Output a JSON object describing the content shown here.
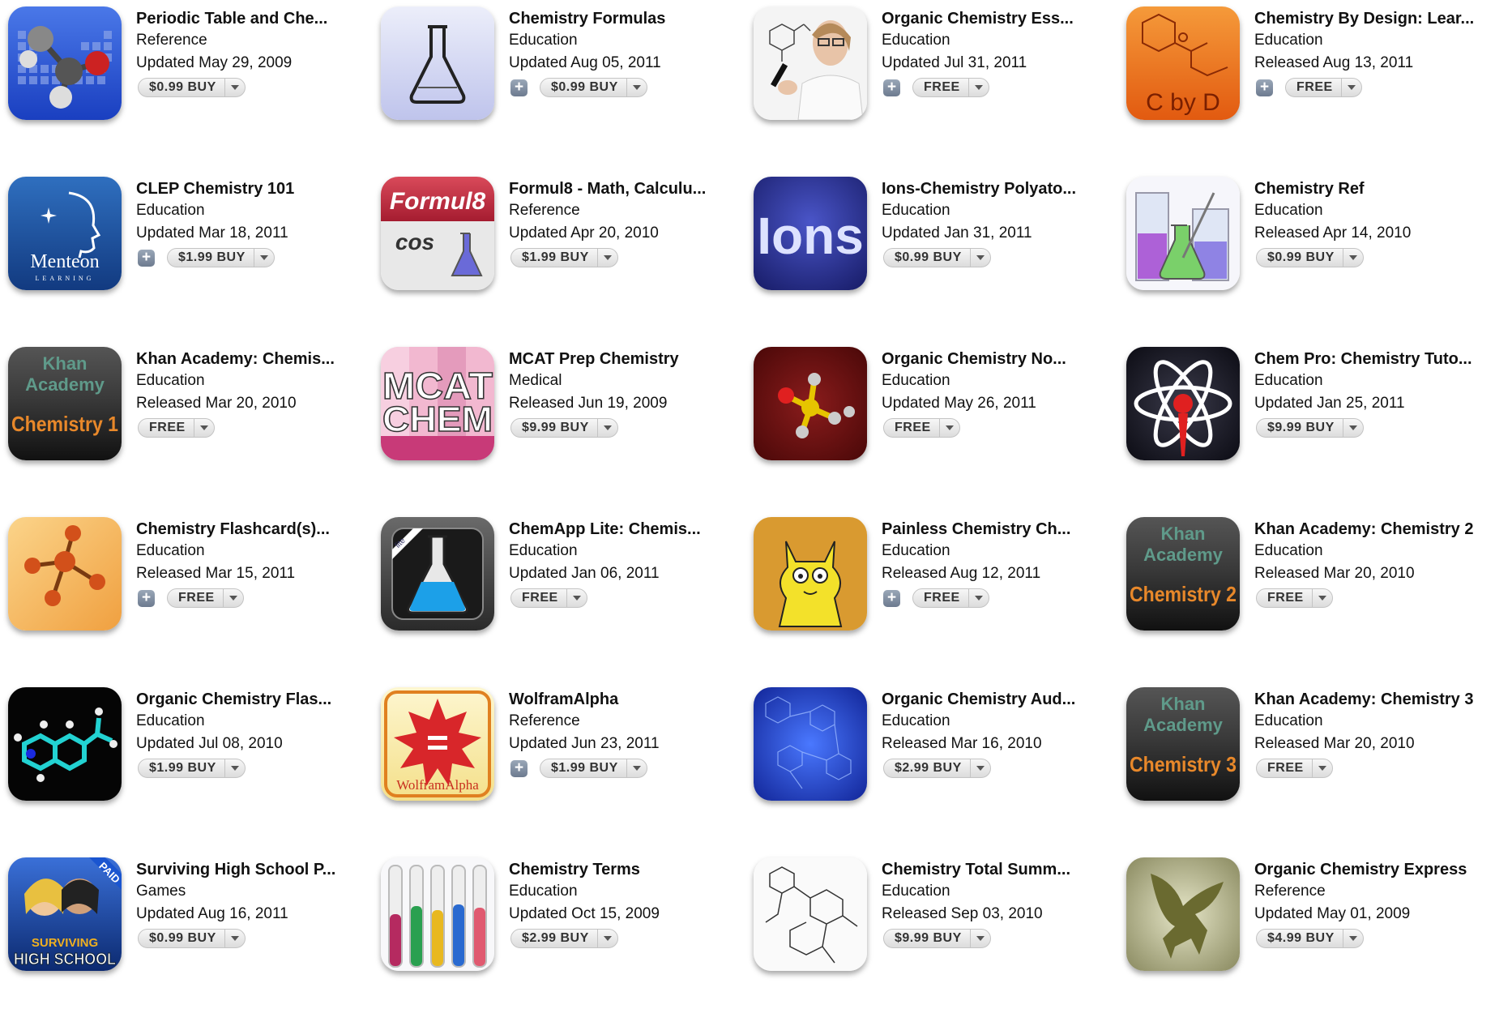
{
  "apps": [
    {
      "name": "Periodic Table and Che...",
      "category": "Reference",
      "date": "Updated May 29, 2009",
      "price": "$0.99  BUY",
      "plus": false,
      "icon": "periodic-table-icon"
    },
    {
      "name": "Chemistry Formulas",
      "category": "Education",
      "date": "Updated Aug 05, 2011",
      "price": "$0.99  BUY",
      "plus": true,
      "icon": "flask-icon"
    },
    {
      "name": "Organic Chemistry Ess...",
      "category": "Education",
      "date": "Updated Jul 31, 2011",
      "price": "FREE",
      "plus": true,
      "icon": "scientist-icon"
    },
    {
      "name": "Chemistry By Design: Lear...",
      "category": "Education",
      "date": "Released Aug 13, 2011",
      "price": "FREE",
      "plus": true,
      "icon": "c-by-d-icon"
    },
    {
      "name": "CLEP Chemistry 101",
      "category": "Education",
      "date": "Updated Mar 18, 2011",
      "price": "$1.99  BUY",
      "plus": true,
      "icon": "menteon-icon"
    },
    {
      "name": "Formul8 - Math, Calculu...",
      "category": "Reference",
      "date": "Updated Apr 20, 2010",
      "price": "$1.99  BUY",
      "plus": false,
      "icon": "formul8-icon"
    },
    {
      "name": "Ions-Chemistry Polyato...",
      "category": "Education",
      "date": "Updated Jan 31, 2011",
      "price": "$0.99  BUY",
      "plus": false,
      "icon": "ions-icon"
    },
    {
      "name": "Chemistry Ref",
      "category": "Education",
      "date": "Released Apr 14, 2010",
      "price": "$0.99  BUY",
      "plus": false,
      "icon": "beakers-icon"
    },
    {
      "name": "Khan Academy: Chemis...",
      "category": "Education",
      "date": "Released Mar 20, 2010",
      "price": "FREE",
      "plus": false,
      "icon": "khan-chemistry-1-icon"
    },
    {
      "name": "MCAT Prep Chemistry",
      "category": "Medical",
      "date": "Released Jun 19, 2009",
      "price": "$9.99  BUY",
      "plus": false,
      "icon": "mcat-chem-icon"
    },
    {
      "name": "Organic Chemistry No...",
      "category": "Education",
      "date": "Updated May 26, 2011",
      "price": "FREE",
      "plus": false,
      "icon": "molecule-icon"
    },
    {
      "name": "Chem Pro: Chemistry Tuto...",
      "category": "Education",
      "date": "Updated Jan 25, 2011",
      "price": "$9.99  BUY",
      "plus": false,
      "icon": "atom-icon"
    },
    {
      "name": "Chemistry Flashcard(s)...",
      "category": "Education",
      "date": "Released Mar 15, 2011",
      "price": "FREE",
      "plus": true,
      "icon": "flashcard-molecule-icon"
    },
    {
      "name": "ChemApp Lite: Chemis...",
      "category": "Education",
      "date": "Updated Jan 06, 2011",
      "price": "FREE",
      "plus": false,
      "icon": "chemapp-flask-icon"
    },
    {
      "name": "Painless Chemistry Ch...",
      "category": "Education",
      "date": "Released Aug 12, 2011",
      "price": "FREE",
      "plus": true,
      "icon": "cartoon-cat-icon"
    },
    {
      "name": "Khan Academy: Chemistry 2",
      "category": "Education",
      "date": "Released Mar 20, 2010",
      "price": "FREE",
      "plus": false,
      "icon": "khan-chemistry-2-icon"
    },
    {
      "name": "Organic Chemistry Flas...",
      "category": "Education",
      "date": "Updated Jul 08, 2010",
      "price": "$1.99  BUY",
      "plus": false,
      "icon": "organic-molecule-icon"
    },
    {
      "name": "WolframAlpha",
      "category": "Reference",
      "date": "Updated Jun 23, 2011",
      "price": "$1.99  BUY",
      "plus": true,
      "icon": "wolframalpha-icon"
    },
    {
      "name": "Organic Chemistry Aud...",
      "category": "Education",
      "date": "Released Mar 16, 2010",
      "price": "$2.99  BUY",
      "plus": false,
      "icon": "blue-structures-icon"
    },
    {
      "name": "Khan Academy: Chemistry 3",
      "category": "Education",
      "date": "Released Mar 20, 2010",
      "price": "FREE",
      "plus": false,
      "icon": "khan-chemistry-3-icon"
    },
    {
      "name": "Surviving High School P...",
      "category": "Games",
      "date": "Updated Aug 16, 2011",
      "price": "$0.99  BUY",
      "plus": false,
      "icon": "surviving-high-school-icon"
    },
    {
      "name": "Chemistry Terms",
      "category": "Education",
      "date": "Updated Oct 15, 2009",
      "price": "$2.99  BUY",
      "plus": false,
      "icon": "test-tubes-icon"
    },
    {
      "name": "Chemistry Total Summ...",
      "category": "Education",
      "date": "Released Sep 03, 2010",
      "price": "$9.99  BUY",
      "plus": false,
      "icon": "structure-sketch-icon"
    },
    {
      "name": "Organic Chemistry Express",
      "category": "Reference",
      "date": "Updated May 01, 2009",
      "price": "$4.99  BUY",
      "plus": false,
      "icon": "pegasus-icon"
    }
  ],
  "icon_text": {
    "cbyd": "C by D",
    "menteon": "Menteon",
    "menteon_sub": "LEARNING",
    "formul8": "Formul8",
    "cos": "cos",
    "ions": "Ions",
    "khan1": "Khan",
    "khan2": "Academy",
    "chem1": "Chemistry 1",
    "chem2": "Chemistry 2",
    "chem3": "Chemistry 3",
    "mcat": "MCAT",
    "chem": "CHEM",
    "lite": "lite",
    "wolfram": "WolframAlpha",
    "paid": "PAID",
    "surviving": "SURVIVING",
    "highschool": "HIGH SCHOOL"
  }
}
